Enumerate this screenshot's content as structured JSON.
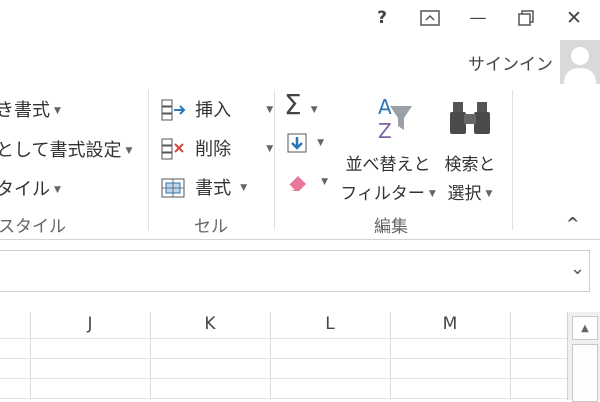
{
  "window": {
    "help_icon": "question-mark-icon",
    "ribbon_display_icon": "ribbon-display-options-icon",
    "minimize_icon": "minimize-icon",
    "restore_icon": "restore-icon",
    "close_icon": "close-icon",
    "help_glyph": "?",
    "minimize_glyph": "—",
    "close_glyph": "✕"
  },
  "account": {
    "signin_label": "サインイン"
  },
  "ribbon": {
    "styles_group": {
      "conditional_format": "き書式",
      "format_as_table": "として書式設定",
      "cell_styles": "タイル",
      "label": "スタイル"
    },
    "cells_group": {
      "insert": "挿入",
      "delete": "削除",
      "format": "書式",
      "label": "セル"
    },
    "editing_group": {
      "autosum_glyph": "Σ",
      "sort_filter_line1": "並べ替えと",
      "sort_filter_line2": "フィルター",
      "find_select_line1": "検索と",
      "find_select_line2": "選択",
      "label": "編集"
    },
    "collapse_glyph": "^"
  },
  "formula_bar": {
    "expand_glyph": "⌄"
  },
  "grid": {
    "columns": [
      "J",
      "K",
      "L",
      "M"
    ]
  },
  "scrollbar": {
    "up_glyph": "▲"
  },
  "colors": {
    "accent_blue": "#2e75b6",
    "eraser_pink": "#e8789a",
    "delete_red": "#d9463b"
  }
}
